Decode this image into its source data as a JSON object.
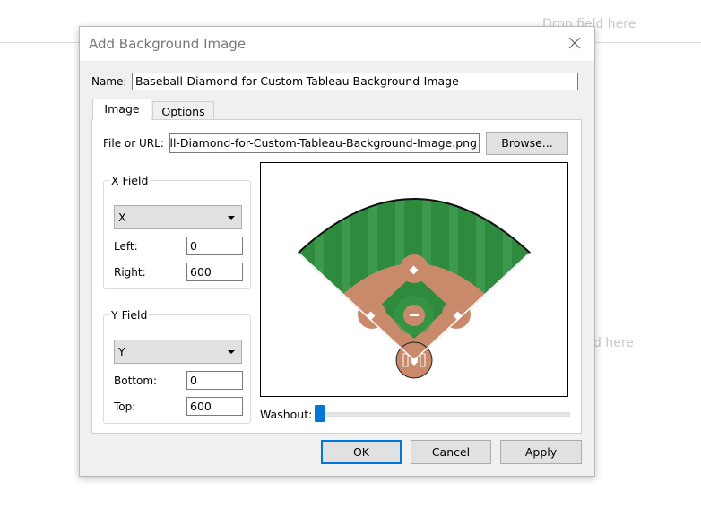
{
  "background": {
    "drop_top": "Drop field here",
    "drop_right": "d here"
  },
  "dialog": {
    "title": "Add Background Image",
    "name_label": "Name:",
    "name_value": "Baseball-Diamond-for-Custom-Tableau-Background-Image",
    "tabs": [
      {
        "label": "Image",
        "selected": true
      },
      {
        "label": "Options",
        "selected": false
      }
    ],
    "file_label": "File or URL:",
    "file_value": "Baseball-Diamond-for-Custom-Tableau-Background-Image.png",
    "browse_label": "Browse...",
    "x_field": {
      "legend": "X Field",
      "selected": "X",
      "left_label": "Left:",
      "left_value": "0",
      "right_label": "Right:",
      "right_value": "600"
    },
    "y_field": {
      "legend": "Y Field",
      "selected": "Y",
      "bottom_label": "Bottom:",
      "bottom_value": "0",
      "top_label": "Top:",
      "top_value": "600"
    },
    "washout_label": "Washout:",
    "washout_value": 0,
    "buttons": {
      "ok": "OK",
      "cancel": "Cancel",
      "apply": "Apply"
    }
  },
  "colors": {
    "accent": "#0078d7",
    "grass": "#2e8b3e",
    "infield_dirt": "#c98a6b"
  }
}
